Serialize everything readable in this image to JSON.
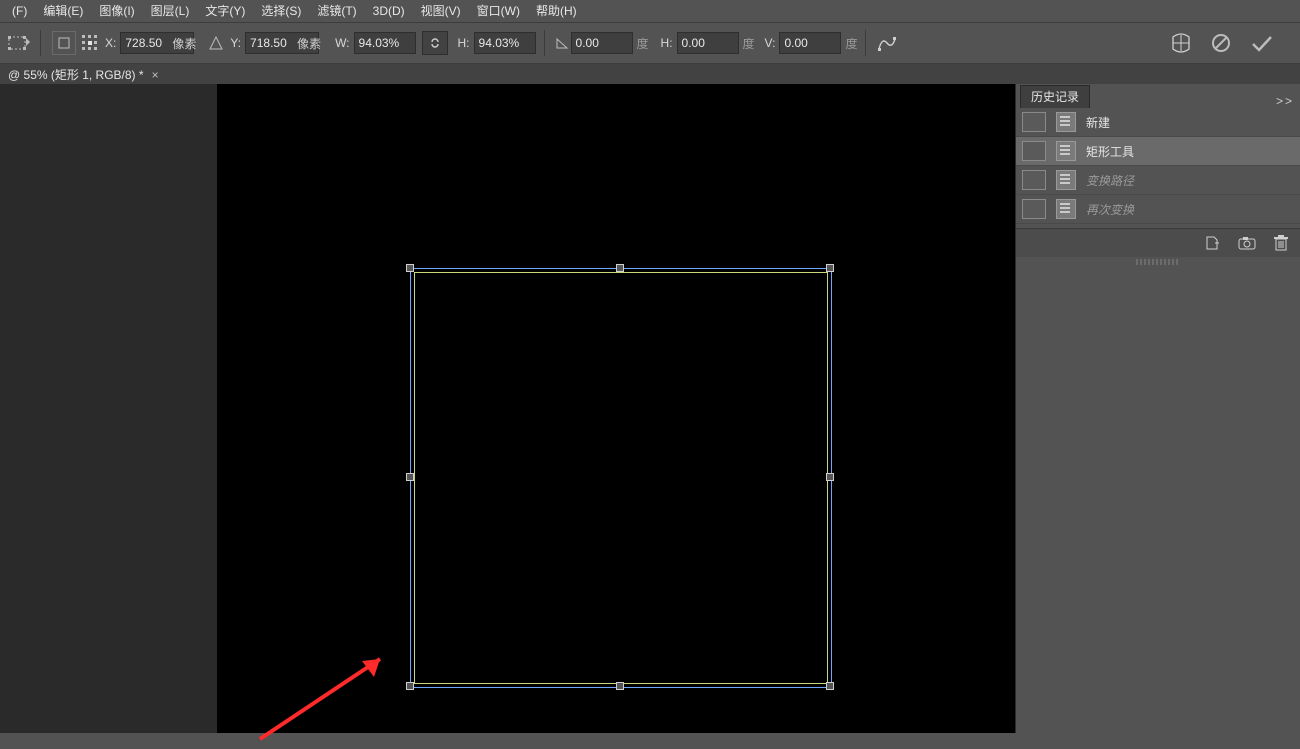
{
  "menu": {
    "items": [
      "(F)",
      "编辑(E)",
      "图像(I)",
      "图层(L)",
      "文字(Y)",
      "选择(S)",
      "滤镜(T)",
      "3D(D)",
      "视图(V)",
      "窗口(W)",
      "帮助(H)"
    ]
  },
  "options": {
    "x_label": "X:",
    "x_value": "728.50",
    "x_unit": "像素",
    "y_label": "Y:",
    "y_value": "718.50",
    "y_unit": "像素",
    "w_label": "W:",
    "w_value": "94.03%",
    "h_label": "H:",
    "h_value": "94.03%",
    "angle_value": "0.00",
    "angle_unit": "度",
    "skew_h_label": "H:",
    "skew_h_value": "0.00",
    "skew_h_unit": "度",
    "skew_v_label": "V:",
    "skew_v_value": "0.00",
    "skew_v_unit": "度",
    "link_icon": "link-icon",
    "interp_icon": "interpolation-icon",
    "warp_icon": "warp-icon",
    "cancel_icon": "cancel-icon",
    "commit_icon": "commit-icon"
  },
  "document": {
    "tab_title": "@ 55% (矩形 1, RGB/8) *"
  },
  "history": {
    "panel_title": "历史记录",
    "items": [
      {
        "label": "新建",
        "state": "normal"
      },
      {
        "label": "矩形工具",
        "state": "selected"
      },
      {
        "label": "变换路径",
        "state": "dimmed"
      },
      {
        "label": "再次变换",
        "state": "dimmed"
      }
    ],
    "footer_icons": [
      "new-doc-icon",
      "snapshot-icon",
      "trash-icon"
    ]
  }
}
